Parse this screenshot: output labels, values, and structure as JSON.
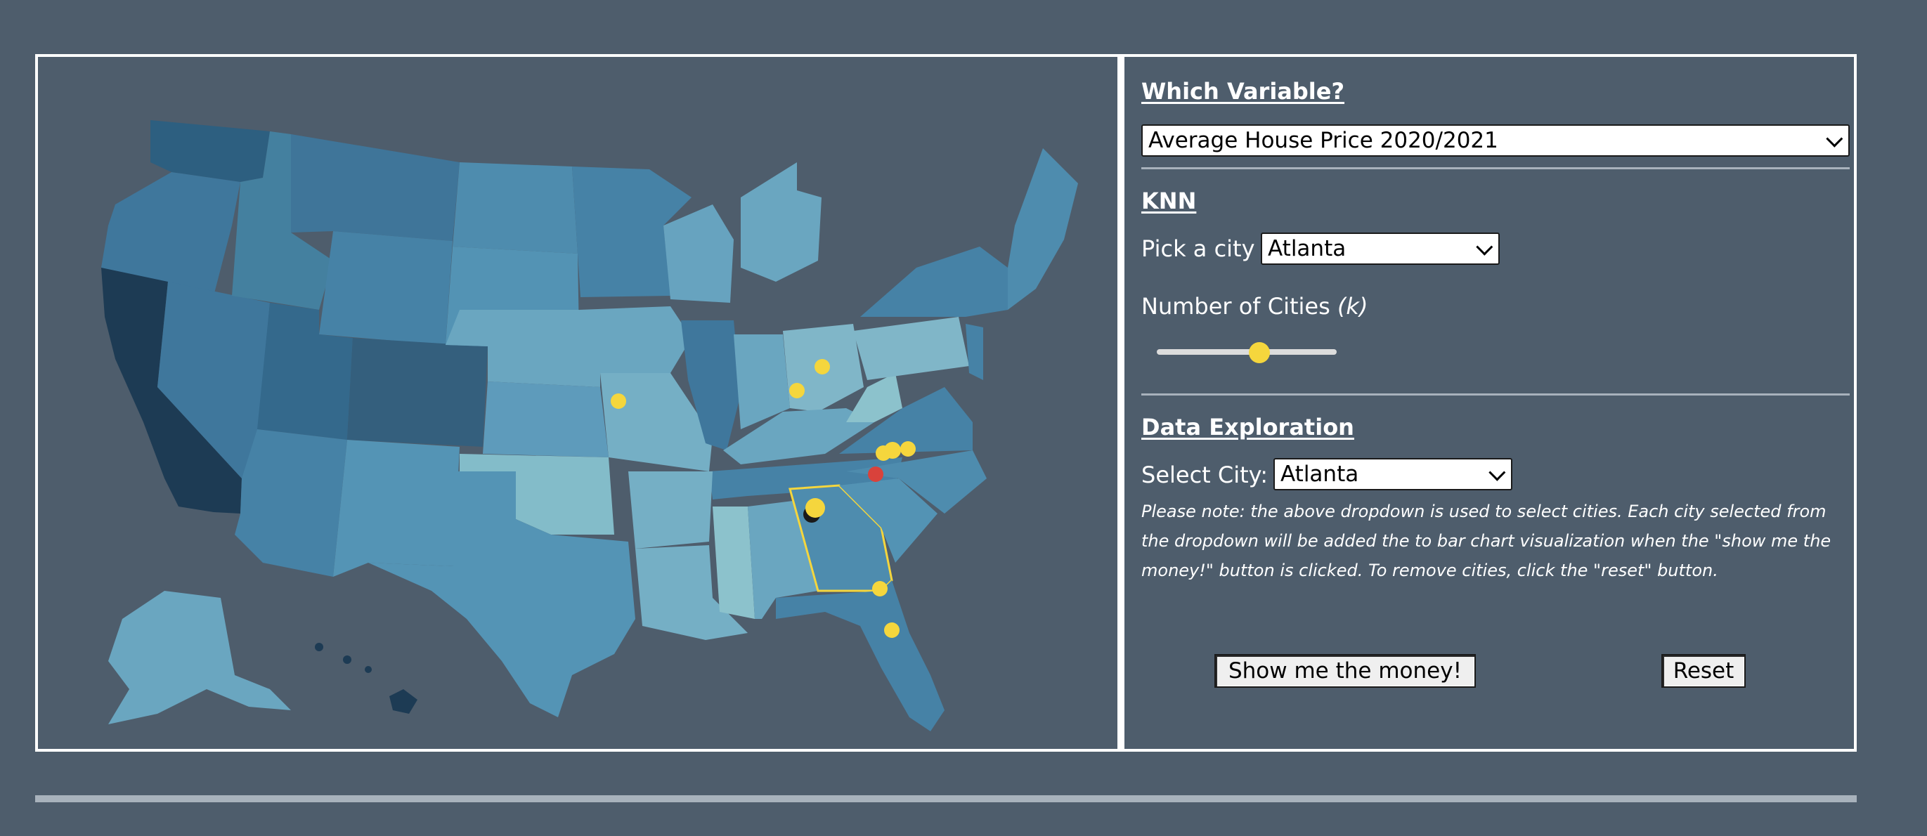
{
  "variable_section": {
    "heading": "Which Variable?",
    "selected_variable": "Average House Price 2020/2021"
  },
  "knn_section": {
    "heading": "KNN",
    "pick_city_label": "Pick a city",
    "selected_city": "Atlanta",
    "k_label": "Number of Cities",
    "k_symbol": "(k)",
    "k_slider_fraction": 0.57
  },
  "exploration_section": {
    "heading": "Data Exploration",
    "select_city_label": "Select City:",
    "selected_city": "Atlanta",
    "note": "Please note: the above dropdown is used to select cities. Each city selected from the dropdown will be added the to bar chart visualization when the \"show me the money!\" button is clicked. To remove cities, click the \"reset\" button.",
    "show_button_label": "Show me the money!",
    "reset_button_label": "Reset"
  },
  "map": {
    "highlighted_state": "Georgia",
    "selected_city": "Atlanta",
    "colors": {
      "highlight_outline": "#f5d63d",
      "neighbor_marker": "#f5d63d",
      "selected_marker": "#f5d63d",
      "outlier_marker": "#d9423b",
      "background": "#4e5d6c"
    }
  }
}
